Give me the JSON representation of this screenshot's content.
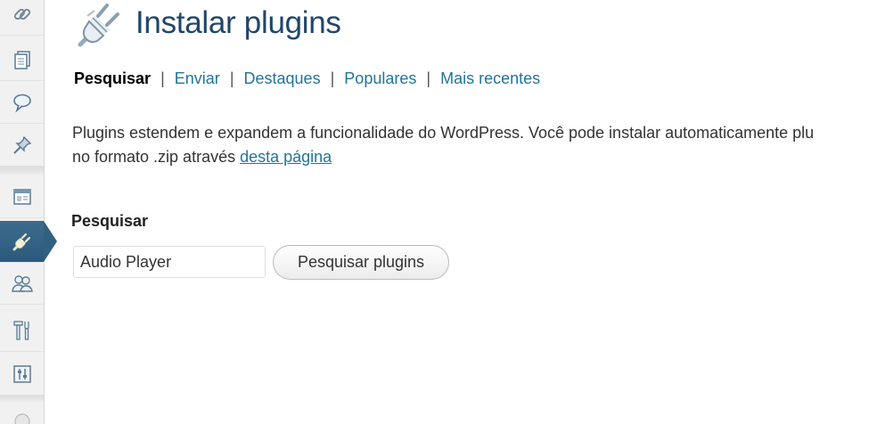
{
  "sidebar": {
    "items": [
      {
        "icon": "link-icon"
      },
      {
        "icon": "pages-icon"
      },
      {
        "icon": "comments-icon"
      },
      {
        "icon": "pin-icon"
      },
      {
        "icon": "appearance-icon"
      },
      {
        "icon": "plugin-icon",
        "active": true
      },
      {
        "icon": "users-icon"
      },
      {
        "icon": "tools-icon"
      },
      {
        "icon": "settings-icon"
      }
    ],
    "active_color": "#32607f"
  },
  "header": {
    "icon": "plugin-icon",
    "title": "Instalar plugins",
    "title_color": "#21466a"
  },
  "subnav": {
    "items": [
      {
        "label": "Pesquisar",
        "current": true
      },
      {
        "label": "Enviar"
      },
      {
        "label": "Destaques"
      },
      {
        "label": "Populares"
      },
      {
        "label": "Mais recentes"
      }
    ],
    "separator": "|",
    "link_color": "#21759b"
  },
  "description": {
    "line1": "Plugins estendem e expandem a funcionalidade do WordPress. Você pode instalar automaticamente plu",
    "line2_prefix": "no formato .zip através ",
    "line2_link": "desta página"
  },
  "search": {
    "heading": "Pesquisar",
    "input_value": "Audio Player",
    "button_label": "Pesquisar plugins"
  }
}
